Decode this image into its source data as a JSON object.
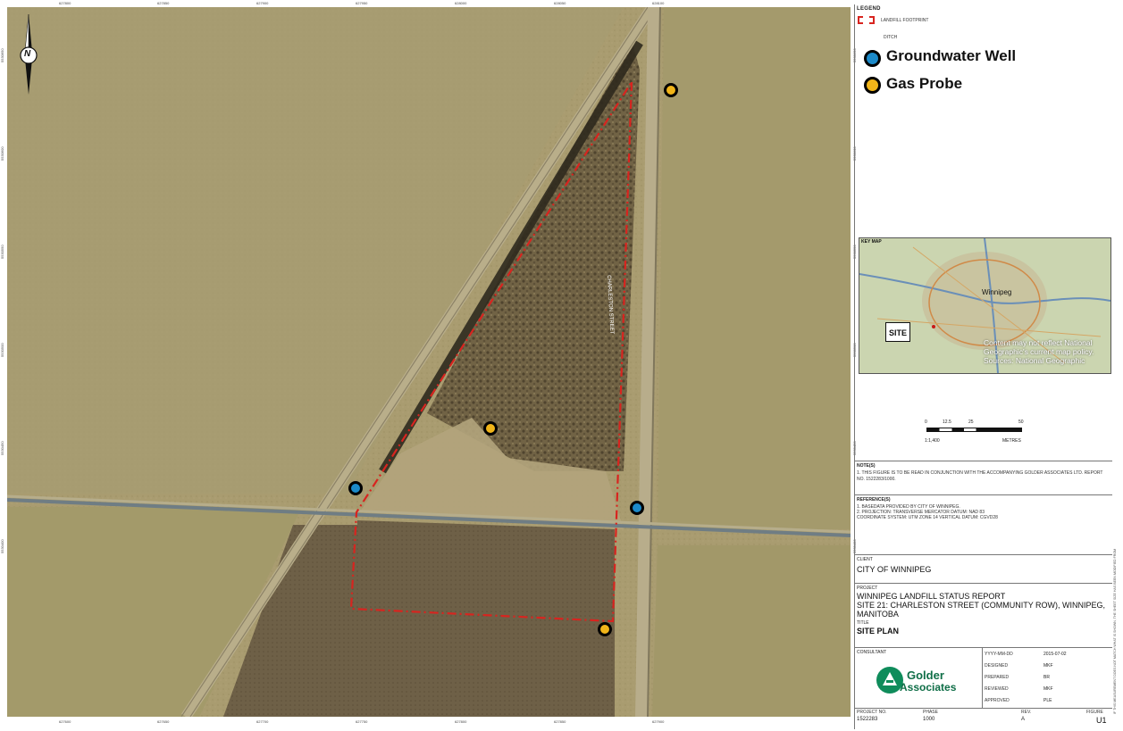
{
  "map": {
    "north_arrow_letter": "N",
    "street_label": "CHARLESTON STREET",
    "top_ticks": [
      "627800",
      "627850",
      "627900",
      "627950",
      "628000",
      "628050",
      "628100"
    ],
    "bottom_ticks": [
      "627600",
      "627650",
      "627700",
      "627750",
      "627800",
      "627850",
      "627900"
    ],
    "left_ticks": [
      "5530650",
      "5530600",
      "5530550",
      "5530500",
      "5530450",
      "5530400"
    ],
    "right_ticks": [
      "5530650",
      "5530600",
      "5530550",
      "5530500",
      "5530450",
      "5530400"
    ],
    "colors": {
      "footprint": "#d8241f",
      "groundwater_well": "#1c8ac9",
      "gas_probe": "#f0b419"
    },
    "icons": [
      "north-arrow-icon",
      "groundwater-well-marker",
      "gas-probe-marker"
    ]
  },
  "legend": {
    "title": "LEGEND",
    "footprint_label": "LANDFILL FOOTPRINT",
    "ditch_label": "DITCH",
    "groundwater_label": "Groundwater Well",
    "gas_probe_label": "Gas Probe"
  },
  "keymap": {
    "label": "KEY MAP",
    "city": "Winnipeg",
    "site_label": "SITE",
    "disclaimer": "Content may not reflect National Geographic's current map policy. Sources: National Geographic"
  },
  "scale": {
    "ticks": [
      "0",
      "12.5",
      "25",
      "50"
    ],
    "ratio": "1:1,400",
    "units": "METRES"
  },
  "notes": {
    "title": "NOTE(S)",
    "text": "1. THIS FIGURE IS TO BE READ IN CONJUNCTION WITH THE ACCOMPANYING GOLDER ASSOCIATES LTD. REPORT NO. 1522283/1000."
  },
  "references": {
    "title": "REFERENCE(S)",
    "line1": "1. BASEDATA PROVIDED BY CITY OF WINNIPEG.",
    "line2": "2. PROJECTION: TRANSVERSE MERCATOR  DATUM: NAD 83",
    "line3": "COORDINATE SYSTEM: UTM ZONE 14  VERTICAL DATUM: CGVD28"
  },
  "client": {
    "label": "CLIENT",
    "name": "CITY OF WINNIPEG"
  },
  "project": {
    "label": "PROJECT",
    "line1": "WINNIPEG LANDFILL STATUS REPORT",
    "line2": "SITE 21: CHARLESTON STREET (COMMUNITY ROW), WINNIPEG,",
    "line3": "MANITOBA"
  },
  "title_block": {
    "label": "TITLE",
    "title": "SITE PLAN"
  },
  "consultant": {
    "label": "CONSULTANT",
    "company_line1": "Golder",
    "company_line2": "Associates",
    "rows": [
      {
        "label": "YYYY-MM-DD",
        "value": "2015-07-02"
      },
      {
        "label": "DESIGNED",
        "value": "MKF"
      },
      {
        "label": "PREPARED",
        "value": "BR"
      },
      {
        "label": "REVIEWED",
        "value": "MKF"
      },
      {
        "label": "APPROVED",
        "value": "PLE"
      }
    ]
  },
  "footer": {
    "project_no_label": "PROJECT NO.",
    "project_no": "1522283",
    "phase_label": "PHASE",
    "phase": "1000",
    "rev_label": "REV.",
    "rev": "A",
    "figure_label": "FIGURE",
    "figure": "U1"
  },
  "side_note": "IF THIS MEASUREMENT DOES NOT MATCH WHAT IS SHOWN, THE SHEET SIZE HAS BEEN MODIFIED FROM"
}
